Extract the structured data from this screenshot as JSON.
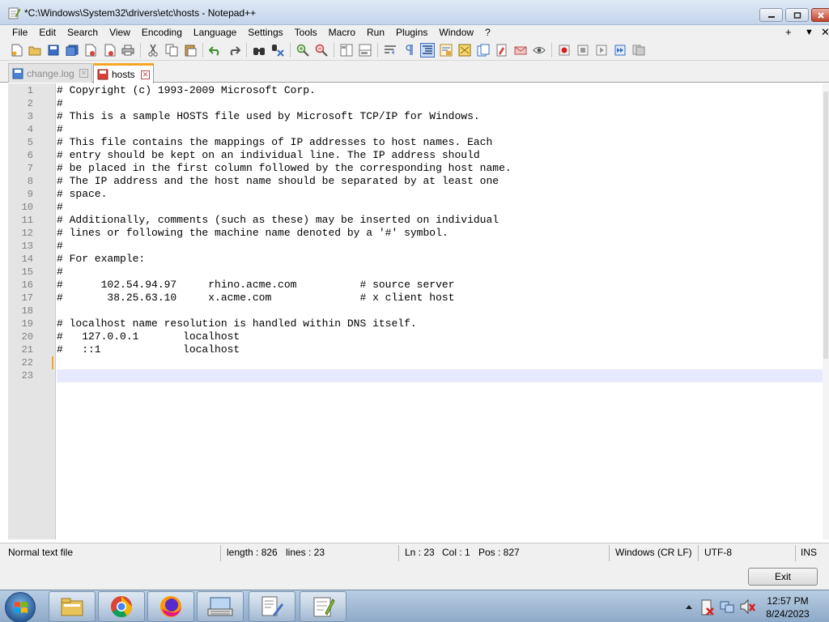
{
  "window": {
    "title": "*C:\\Windows\\System32\\drivers\\etc\\hosts - Notepad++",
    "icon": "notepad-plus-plus-icon",
    "buttons": [
      "minimize-icon",
      "maximize-icon",
      "close-icon"
    ]
  },
  "menu": {
    "items": [
      "File",
      "Edit",
      "Search",
      "View",
      "Encoding",
      "Language",
      "Settings",
      "Tools",
      "Macro",
      "Run",
      "Plugins",
      "Window",
      "?"
    ],
    "right": [
      "+",
      "▼",
      "✕"
    ]
  },
  "toolbar": {
    "icons": [
      "new-file-icon",
      "open-file-icon",
      "save-icon",
      "save-all-icon",
      "close-icon",
      "close-all-icon",
      "print-icon",
      "cut-icon",
      "copy-icon",
      "paste-icon",
      "undo-icon",
      "redo-icon",
      "find-icon",
      "replace-icon",
      "zoom-in-icon",
      "zoom-out-icon",
      "sync-vertical-icon",
      "sync-horizontal-icon",
      "word-wrap-icon",
      "show-all-chars-icon",
      "indent-guide-icon",
      "udl-icon",
      "document-map-icon",
      "function-list-icon",
      "folder-workspace-icon",
      "doc-monitor-icon",
      "record-macro-icon",
      "stop-record-icon",
      "play-macro-icon",
      "play-multiple-icon",
      "save-macro-icon"
    ]
  },
  "tabs": [
    {
      "label": "change.log",
      "active": false,
      "icon": "saved-file-icon"
    },
    {
      "label": "hosts",
      "active": true,
      "icon": "unsaved-file-icon"
    }
  ],
  "editor": {
    "lines": [
      "# Copyright (c) 1993-2009 Microsoft Corp.",
      "#",
      "# This is a sample HOSTS file used by Microsoft TCP/IP for Windows.",
      "#",
      "# This file contains the mappings of IP addresses to host names. Each",
      "# entry should be kept on an individual line. The IP address should",
      "# be placed in the first column followed by the corresponding host name.",
      "# The IP address and the host name should be separated by at least one",
      "# space.",
      "#",
      "# Additionally, comments (such as these) may be inserted on individual",
      "# lines or following the machine name denoted by a '#' symbol.",
      "#",
      "# For example:",
      "#",
      "#      102.54.94.97     rhino.acme.com          # source server",
      "#       38.25.63.10     x.acme.com              # x client host",
      "",
      "# localhost name resolution is handled within DNS itself.",
      "#   127.0.0.1       localhost",
      "#   ::1             localhost",
      "",
      ""
    ],
    "line_numbers": [
      "1",
      "2",
      "3",
      "4",
      "5",
      "6",
      "7",
      "8",
      "9",
      "10",
      "11",
      "12",
      "13",
      "14",
      "15",
      "16",
      "17",
      "18",
      "19",
      "20",
      "21",
      "22",
      "23"
    ],
    "current_line": 23
  },
  "status": {
    "file_type": "Normal text file",
    "length": "length : 826",
    "lines": "lines : 23",
    "ln": "Ln : 23",
    "col": "Col : 1",
    "pos": "Pos : 827",
    "eol": "Windows (CR LF)",
    "encoding": "UTF-8",
    "mode": "INS"
  },
  "dialog": {
    "exit_label": "Exit"
  },
  "taskbar": {
    "apps": [
      "file-explorer-icon",
      "chrome-icon",
      "firefox-icon",
      "keyboard-app-icon",
      "documents-app-icon",
      "notepad-plus-plus-icon"
    ],
    "tray_icons": [
      "tray-up-arrow-icon",
      "action-center-icon",
      "network-icon",
      "volume-muted-icon"
    ],
    "time": "12:57 PM",
    "date": "8/24/2023"
  }
}
